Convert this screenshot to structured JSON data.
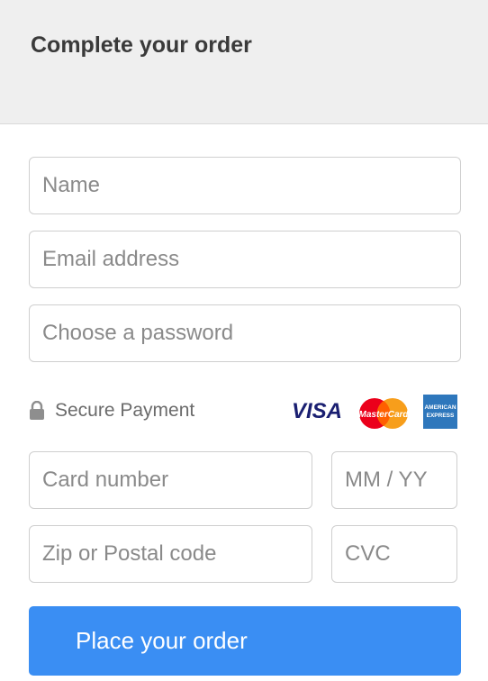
{
  "header": {
    "title": "Complete your order"
  },
  "form": {
    "name_placeholder": "Name",
    "email_placeholder": "Email address",
    "password_placeholder": "Choose a password",
    "card_number_placeholder": "Card number",
    "expiry_placeholder": "MM / YY",
    "zip_placeholder": "Zip or Postal code",
    "cvc_placeholder": "CVC"
  },
  "payment": {
    "secure_label": "Secure Payment",
    "icons": [
      "lock-icon",
      "visa-logo",
      "mastercard-logo",
      "amex-logo"
    ],
    "visa_text": "VISA",
    "mastercard_text": "MasterCard",
    "amex_text_1": "AMERICAN",
    "amex_text_2": "EXPRESS"
  },
  "submit": {
    "label": "Place your order"
  },
  "colors": {
    "header_bg": "#efefef",
    "button_bg": "#3a8ef3",
    "visa_blue": "#1a1f71",
    "mc_red": "#eb001b",
    "mc_orange": "#f79e1b",
    "amex_blue": "#2e77bc"
  }
}
